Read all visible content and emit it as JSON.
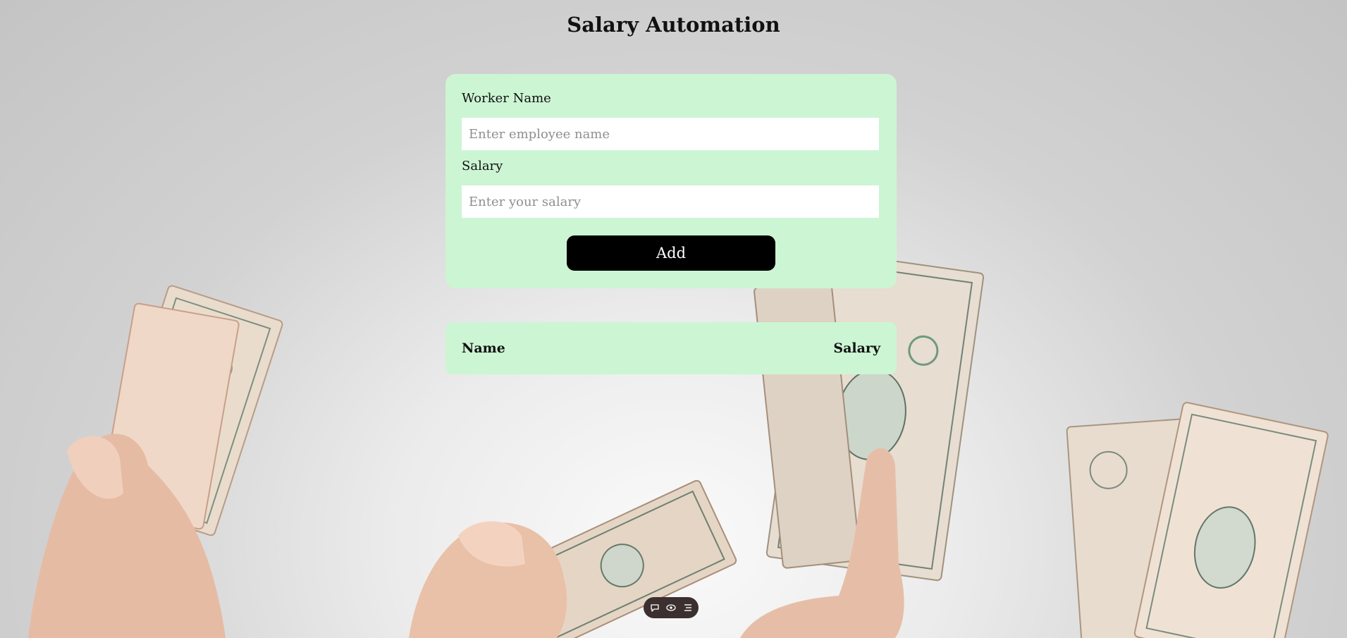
{
  "page": {
    "title": "Salary Automation"
  },
  "form": {
    "worker_label": "Worker Name",
    "worker_placeholder": "Enter employee name",
    "worker_value": "",
    "salary_label": "Salary",
    "salary_placeholder": "Enter your salary",
    "salary_value": "",
    "add_label": "Add"
  },
  "table": {
    "headers": [
      "Name",
      "Salary"
    ],
    "rows": []
  },
  "toolbar": {
    "icons": [
      "comment-icon",
      "eye-icon",
      "menu-icon"
    ]
  },
  "colors": {
    "card_bg": "#ccf5d4",
    "button_bg": "#000000",
    "button_text": "#ffffff",
    "toolbar_bg": "#3b2f2f"
  }
}
